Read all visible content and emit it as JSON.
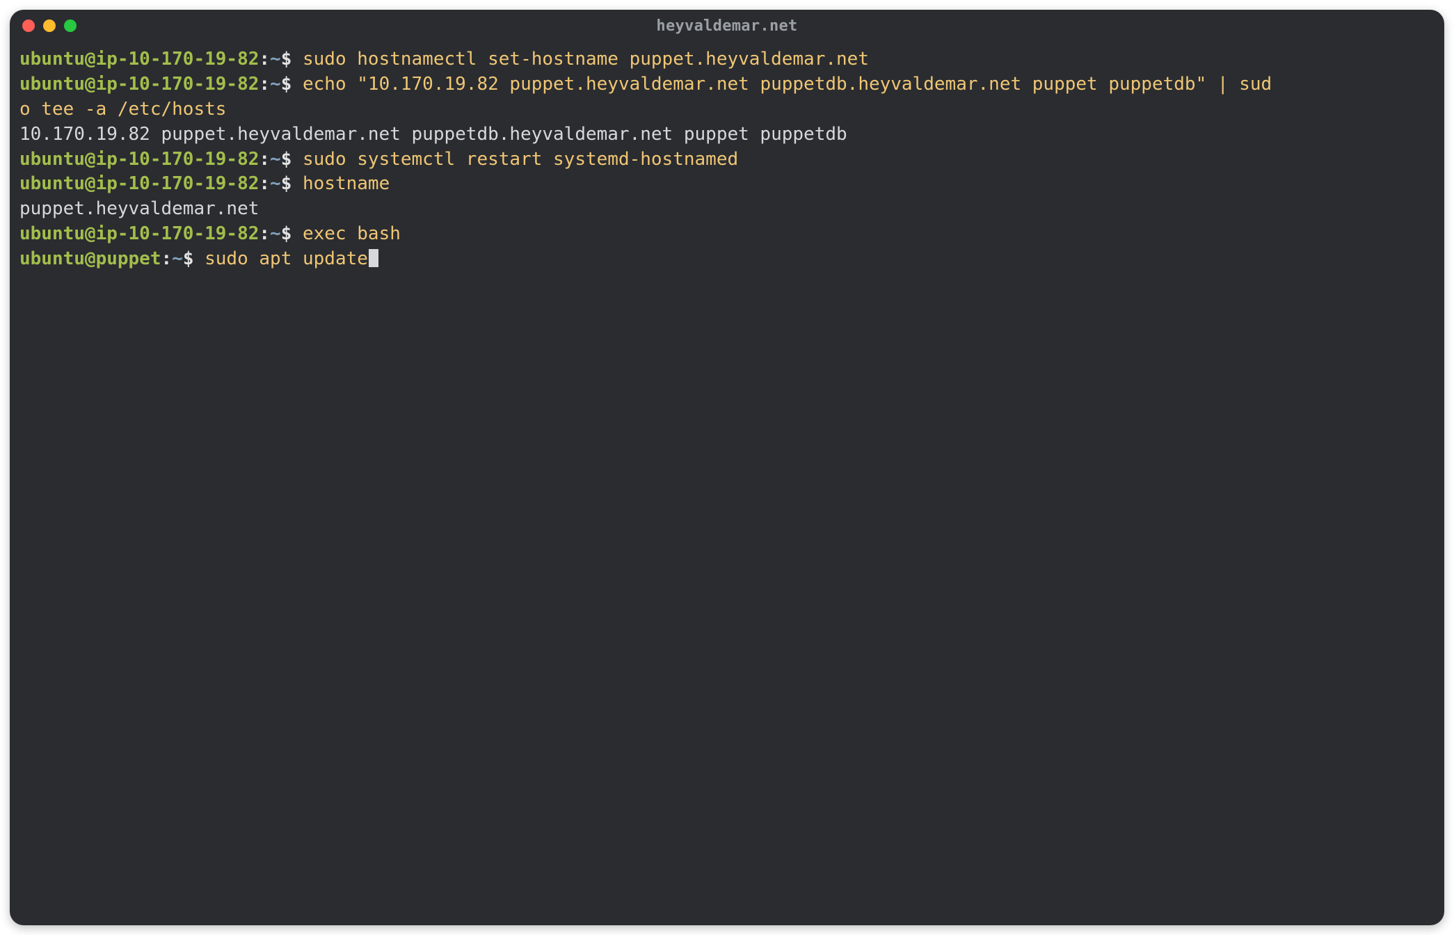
{
  "window": {
    "title": "heyvaldemar.net"
  },
  "colors": {
    "bg": "#2a2c30",
    "red": "#ff5f57",
    "yellow": "#febc2e",
    "green": "#28c840",
    "prompt_user": "#a3be4c",
    "tilde": "#81a2be",
    "command": "#f0c674",
    "text": "#d6d8db"
  },
  "session": {
    "lines": [
      {
        "kind": "prompt",
        "user_host": "ubuntu@ip-10-170-19-82",
        "path": ":",
        "tilde": "~",
        "dollar": "$ ",
        "command": "sudo hostnamectl set-hostname puppet.heyvaldemar.net"
      },
      {
        "kind": "prompt",
        "user_host": "ubuntu@ip-10-170-19-82",
        "path": ":",
        "tilde": "~",
        "dollar": "$ ",
        "command": "echo \"10.170.19.82 puppet.heyvaldemar.net puppetdb.heyvaldemar.net puppet puppetdb\" | sud"
      },
      {
        "kind": "continuation",
        "command": "o tee -a /etc/hosts"
      },
      {
        "kind": "output",
        "text": "10.170.19.82 puppet.heyvaldemar.net puppetdb.heyvaldemar.net puppet puppetdb"
      },
      {
        "kind": "prompt",
        "user_host": "ubuntu@ip-10-170-19-82",
        "path": ":",
        "tilde": "~",
        "dollar": "$ ",
        "command": "sudo systemctl restart systemd-hostnamed"
      },
      {
        "kind": "prompt",
        "user_host": "ubuntu@ip-10-170-19-82",
        "path": ":",
        "tilde": "~",
        "dollar": "$ ",
        "command": "hostname"
      },
      {
        "kind": "output",
        "text": "puppet.heyvaldemar.net"
      },
      {
        "kind": "prompt",
        "user_host": "ubuntu@ip-10-170-19-82",
        "path": ":",
        "tilde": "~",
        "dollar": "$ ",
        "command": "exec bash"
      },
      {
        "kind": "prompt",
        "user_host": "ubuntu@puppet",
        "path": ":",
        "tilde": "~",
        "dollar": "$ ",
        "command": "sudo apt update",
        "cursor": true
      }
    ]
  }
}
